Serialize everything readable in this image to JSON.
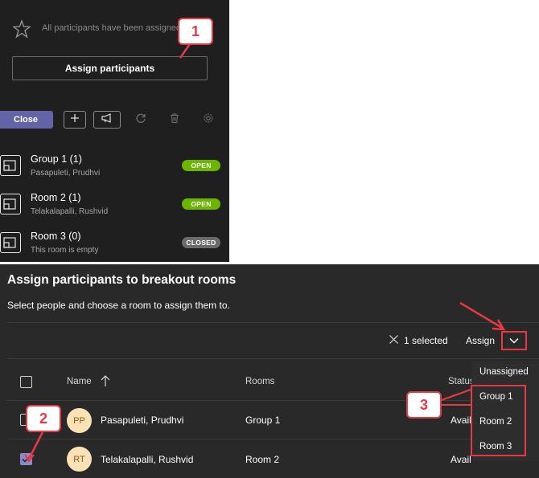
{
  "top_panel": {
    "info_text": "All participants have been assigned",
    "assign_button": "Assign participants",
    "toolbar": {
      "close_label": "Close"
    },
    "rooms": [
      {
        "name": "Group 1 (1)",
        "sub": "Pasapuleti, Prudhvi",
        "status": "OPEN"
      },
      {
        "name": "Room 2 (1)",
        "sub": "Telakalapalli, Rushvid",
        "status": "OPEN"
      },
      {
        "name": "Room 3 (0)",
        "sub": "This room is empty",
        "status": "CLOSED"
      }
    ]
  },
  "dialog": {
    "title": "Assign participants to breakout rooms",
    "subtitle": "Select people and choose a room to assign them to.",
    "selected_count": "1 selected",
    "assign_label": "Assign",
    "columns": {
      "name": "Name",
      "rooms": "Rooms",
      "status": "Status"
    },
    "rows": [
      {
        "initials": "PP",
        "name": "Pasapuleti, Prudhvi",
        "room": "Group 1",
        "status": "Available",
        "checked": false
      },
      {
        "initials": "RT",
        "name": "Telakalapalli, Rushvid",
        "room": "Room 2",
        "status": "Available",
        "checked": true
      }
    ],
    "dropdown_options": [
      "Unassigned",
      "Group 1",
      "Room 2",
      "Room 3"
    ]
  },
  "callouts": {
    "c1": "1",
    "c2": "2",
    "c3": "3"
  },
  "colors": {
    "accent": "#6264a7",
    "open": "#6bb700",
    "closed": "#6b6b6b",
    "callout": "#e63946"
  }
}
